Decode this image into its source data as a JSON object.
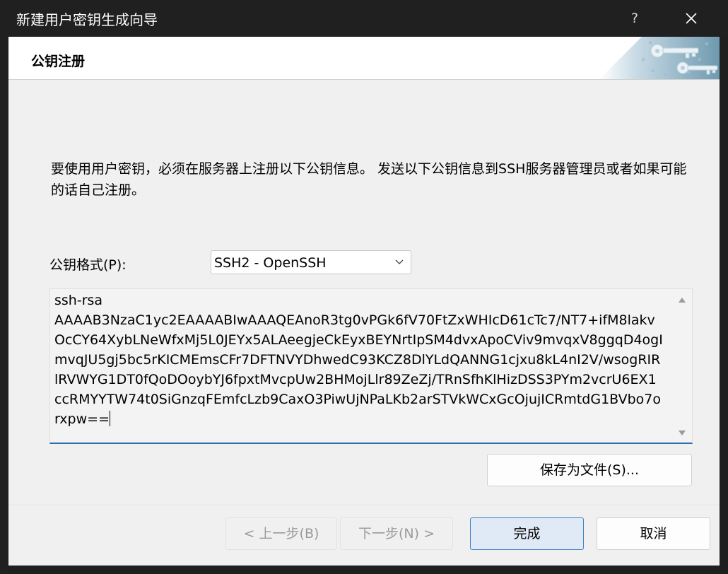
{
  "window": {
    "title": "新建用户密钥生成向导",
    "help_label": "?"
  },
  "header": {
    "title": "公钥注册",
    "art_icon": "keys-banner-icon"
  },
  "description": "要使用用户密钥，必须在服务器上注册以下公钥信息。 发送以下公钥信息到SSH服务器管理员或者如果可能的话自己注册。",
  "format": {
    "label": "公钥格式(P):",
    "value": "SSH2 - OpenSSH"
  },
  "public_key": "ssh-rsa\nAAAAB3NzaC1yc2EAAAABIwAAAQEAnoR3tg0vPGk6fV70FtZxWHIcD61cTc7/NT7+ifM8lakvOcCY64XybLNeWfxMj5L0JEYx5ALAeegjeCkEyxBEYNrtIpSM4dvxApoCViv9mvqxV8ggqD4ogImvqJU5gj5bc5rKICMEmsCFr7DFTNVYDhwedC93KCZ8DlYLdQANNG1cjxu8kL4nI2V/wsogRIRlRVWYG1DT0fQoDOoybYJ6fpxtMvcpUw2BHMojLlr89ZeZj/TRnSfhKlHizDSS3PYm2vcrU6EX1ccRMYYTW74t0SiGnzqFEmfcLzb9CaxO3PiwUjNPaLKb2arSTVkWCxGcOjujICRmtdG1BVbo7orxpw==",
  "buttons": {
    "save": "保存为文件(S)...",
    "back": "< 上一步(B)",
    "next": "下一步(N) >",
    "finish": "完成",
    "cancel": "取消"
  },
  "colors": {
    "accent": "#2f6fb0",
    "titlebar": "#202020",
    "dialog_bg": "#f0f0f0"
  }
}
